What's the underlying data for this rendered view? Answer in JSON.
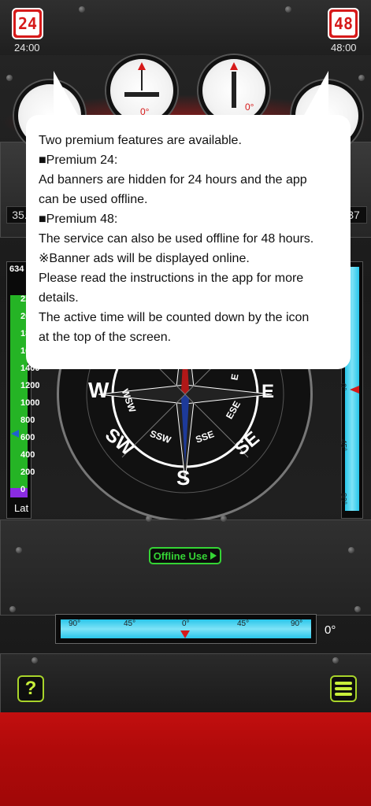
{
  "premium24": {
    "badge": "24",
    "time": "24:00"
  },
  "premium48": {
    "badge": "48",
    "time": "48:00"
  },
  "side_values": {
    "left": "35.",
    "right": "37"
  },
  "altimeter": {
    "top_value": "634",
    "ticks": [
      "22",
      "20",
      "18",
      "16",
      "1400",
      "1200",
      "1000",
      "800",
      "600",
      "400",
      "200",
      "0"
    ],
    "label": "Lat"
  },
  "compass": {
    "cardinals": {
      "w": "W",
      "e": "E",
      "s": "S",
      "sw": "SW",
      "se": "SE"
    },
    "intercardinals": {
      "wsw": "WSW",
      "ssw": "SSW",
      "sse": "SSE",
      "ese": "ESE",
      "ne": "E"
    }
  },
  "pitch": {
    "ticks": [
      "0°",
      "45°",
      "90°"
    ]
  },
  "gauges": {
    "left": "0°",
    "right": "0°"
  },
  "offline_button": {
    "label": "Offline Use"
  },
  "roll": {
    "ticks": [
      "90°",
      "45°",
      "0°",
      "45°",
      "90°"
    ],
    "value": "0°"
  },
  "tooltip": {
    "lines": [
      "Two premium features are available.",
      "■Premium 24:",
      "Ad banners are hidden for 24 hours and the app",
      "can be used offline.",
      "■Premium 48:",
      "The service can also be used offline for 48 hours.",
      "※Banner ads will be displayed online.",
      "Please read the instructions in the app for more",
      "details.",
      "The active time will be counted down by the icon",
      "at the top of the screen."
    ]
  },
  "help_button": {
    "label": "?"
  },
  "colors": {
    "accent_red": "#d61a1a",
    "offline_green": "#35d435",
    "level_blue": "#29c6ea"
  }
}
